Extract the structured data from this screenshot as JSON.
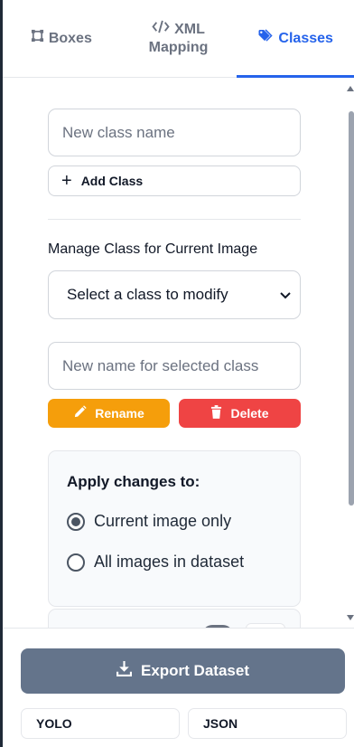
{
  "tabs": [
    {
      "label": "Boxes",
      "icon": "bounding-box-icon",
      "active": false
    },
    {
      "label_line1": "XML",
      "label_line2": "Mapping",
      "icon": "code-icon",
      "active": false
    },
    {
      "label": "Classes",
      "icon": "tags-icon",
      "active": true
    }
  ],
  "classes_panel": {
    "new_class_placeholder": "New class name",
    "add_class_label": "Add Class",
    "manage_title": "Manage Class for Current Image",
    "select_value": "Select a class to modify",
    "rename_placeholder": "New name for selected class",
    "rename_label": "Rename",
    "delete_label": "Delete",
    "apply": {
      "title": "Apply changes to:",
      "options": [
        {
          "label": "Current image only",
          "checked": true
        },
        {
          "label": "All images in dataset",
          "checked": false
        }
      ]
    }
  },
  "footer": {
    "export_label": "Export Dataset",
    "formats": [
      "YOLO",
      "JSON"
    ]
  },
  "colors": {
    "accent": "#2563eb",
    "rename": "#f59e0b",
    "delete": "#ef4444",
    "export": "#64748b"
  }
}
